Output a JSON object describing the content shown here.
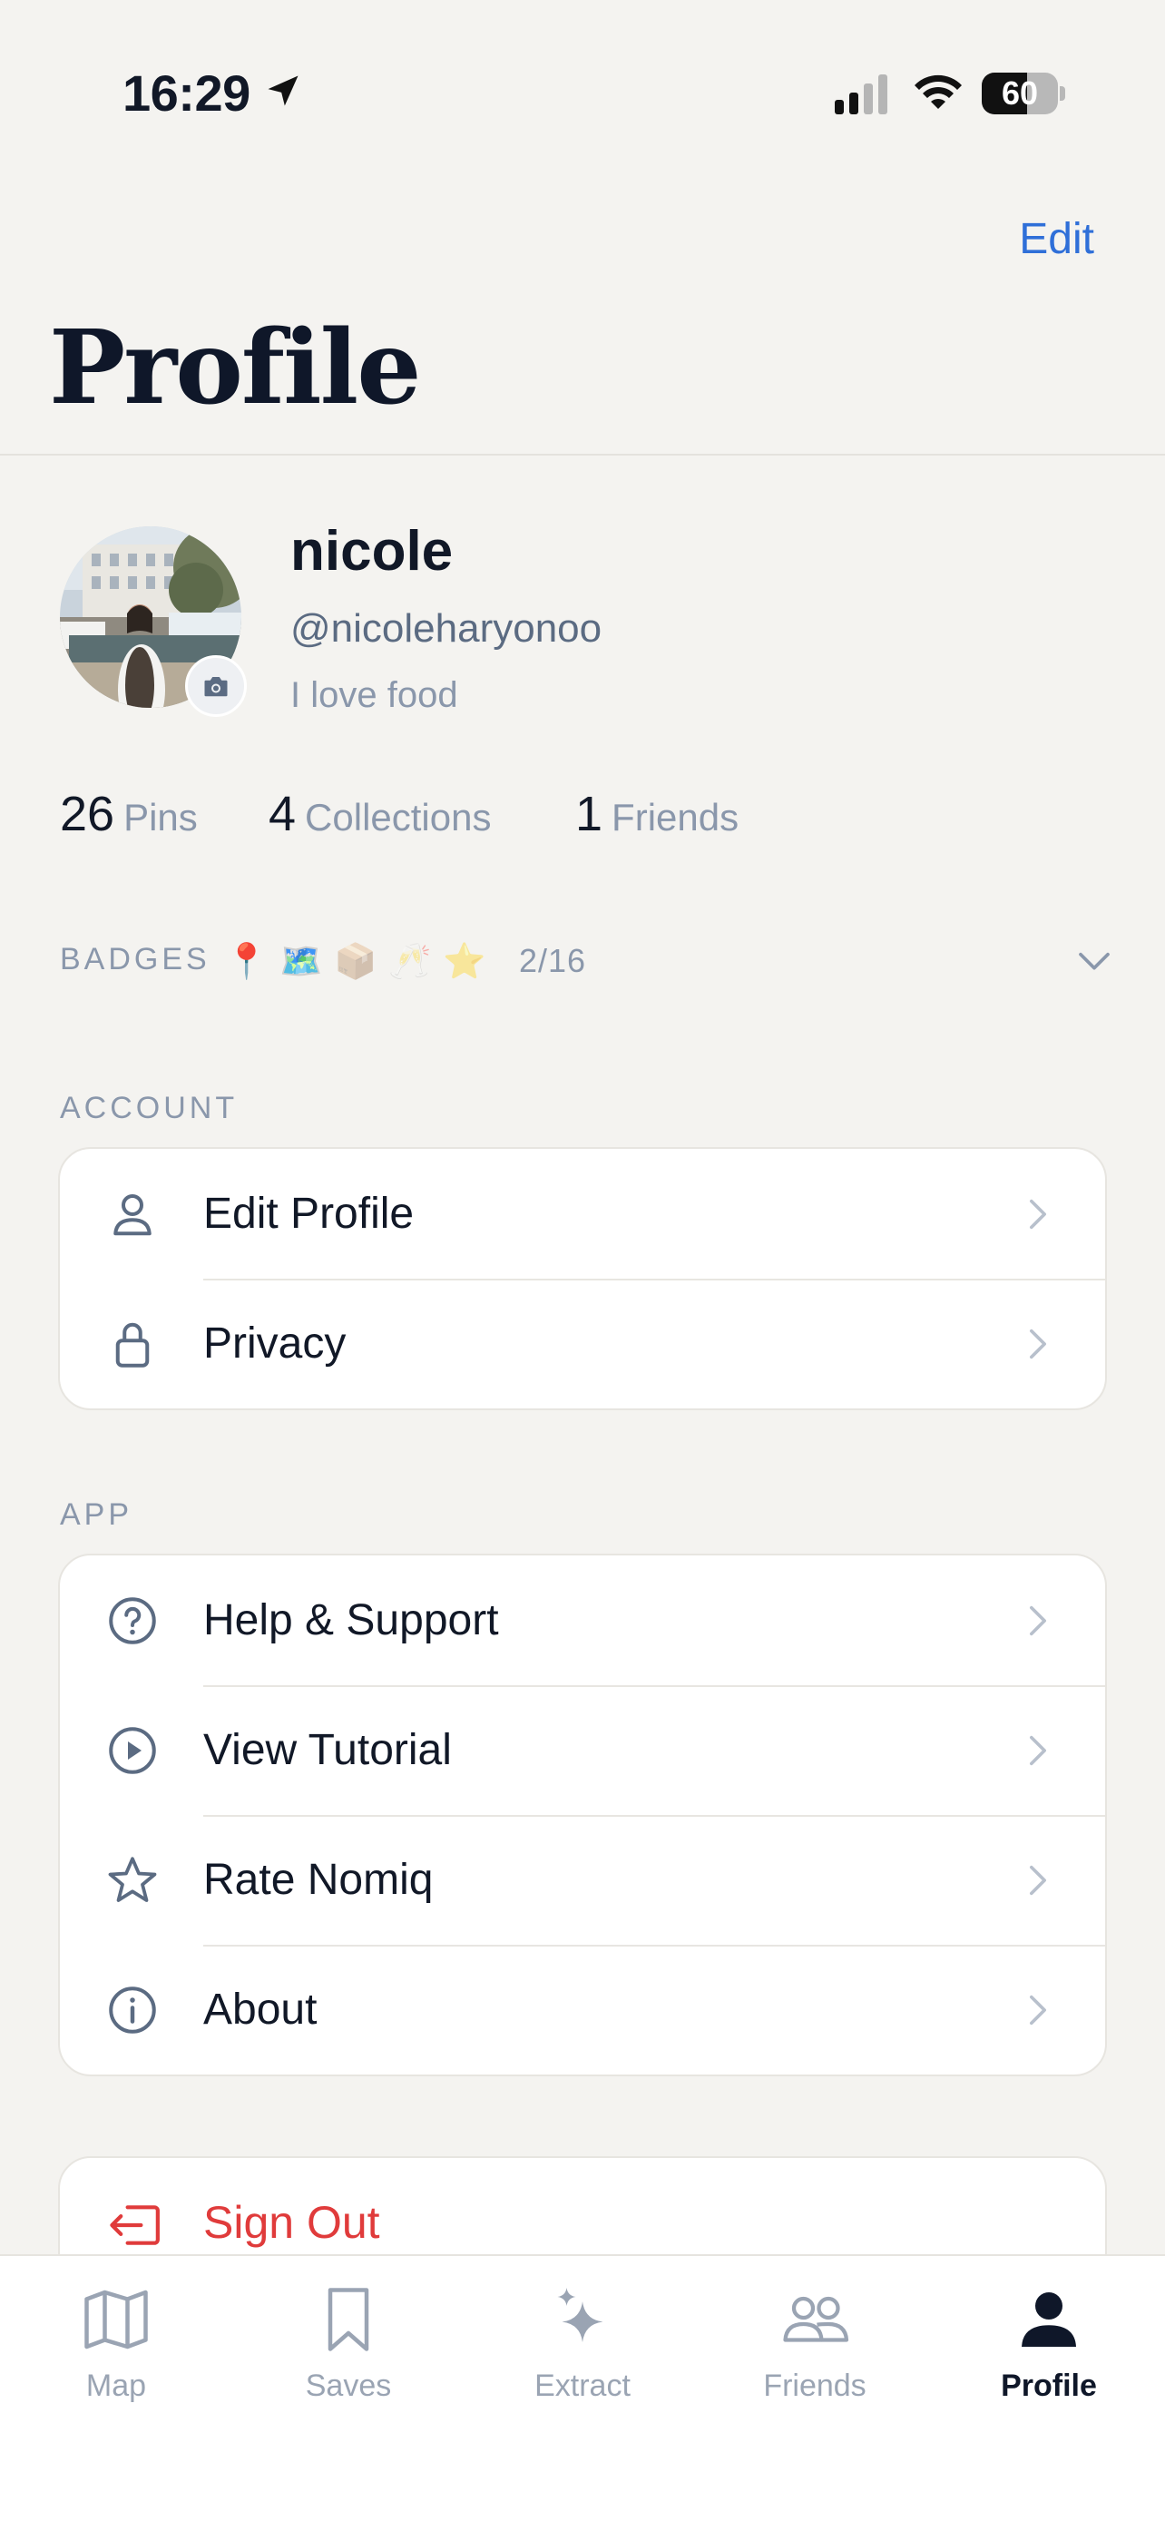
{
  "status_bar": {
    "time": "16:29",
    "battery": "60",
    "battery_level": 0.6
  },
  "header": {
    "edit_label": "Edit",
    "title": "Profile"
  },
  "profile": {
    "name": "nicole",
    "handle": "@nicoleharyonoo",
    "bio": "I love food"
  },
  "stats": [
    {
      "value": "26",
      "label": "Pins"
    },
    {
      "value": "4",
      "label": "Collections"
    },
    {
      "value": "1",
      "label": "Friends"
    }
  ],
  "badges": {
    "label": "BADGES",
    "icons": [
      "📍",
      "🗺️",
      "📦",
      "🥂",
      "⭐"
    ],
    "count": "2/16"
  },
  "account": {
    "label": "ACCOUNT",
    "items": [
      {
        "label": "Edit Profile",
        "icon": "person-icon"
      },
      {
        "label": "Privacy",
        "icon": "lock-icon"
      }
    ]
  },
  "app": {
    "label": "APP",
    "items": [
      {
        "label": "Help & Support",
        "icon": "question-circle-icon"
      },
      {
        "label": "View Tutorial",
        "icon": "play-circle-icon"
      },
      {
        "label": "Rate Nomiq",
        "icon": "star-icon"
      },
      {
        "label": "About",
        "icon": "info-circle-icon"
      }
    ]
  },
  "sign_out": {
    "label": "Sign Out",
    "icon": "sign-out-icon",
    "color": "#e03b3b"
  },
  "tabs": [
    {
      "label": "Map",
      "icon": "map-icon",
      "active": false
    },
    {
      "label": "Saves",
      "icon": "bookmark-icon",
      "active": false
    },
    {
      "label": "Extract",
      "icon": "sparkles-icon",
      "active": false
    },
    {
      "label": "Friends",
      "icon": "friends-icon",
      "active": false
    },
    {
      "label": "Profile",
      "icon": "profile-icon",
      "active": true
    }
  ],
  "colors": {
    "accent": "#2f6fd8",
    "danger": "#e03b3b",
    "background": "#f4f3f0",
    "muted": "#8a97ab"
  }
}
